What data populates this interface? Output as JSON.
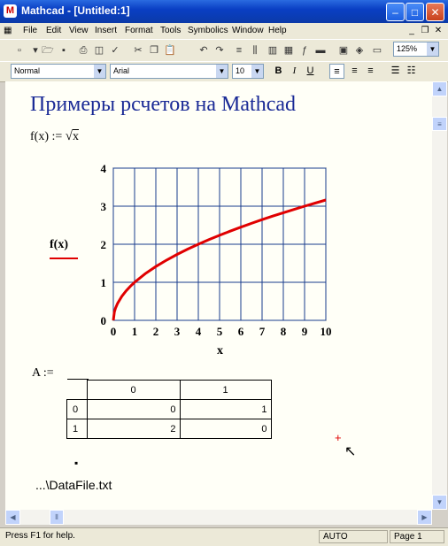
{
  "window": {
    "title": "Mathcad - [Untitled:1]",
    "app_icon": "mathcad-logo-icon"
  },
  "menu": [
    "File",
    "Edit",
    "View",
    "Insert",
    "Format",
    "Tools",
    "Symbolics",
    "Window",
    "Help"
  ],
  "toolbar": {
    "zoom": "125%"
  },
  "format_bar": {
    "style": "Normal",
    "font": "Arial",
    "size": "10"
  },
  "doc": {
    "heading": "Примеры рсчетов на Mathcad",
    "definition": {
      "lhs": "f(x)",
      "assign": ":=",
      "radicand": "x"
    },
    "plot_ylabel": "f(x)",
    "plot_xlabel": "x",
    "matrix_label": "A :=",
    "matrix": {
      "col_headers": [
        "0",
        "1"
      ],
      "row_headers": [
        "0",
        "1"
      ],
      "rows": [
        [
          "0",
          "1"
        ],
        [
          "2",
          "0"
        ]
      ]
    },
    "file_path": "...\\DataFile.txt"
  },
  "chart_data": {
    "type": "line",
    "function": "sqrt(x)",
    "xlim": [
      0,
      10
    ],
    "ylim": [
      0,
      4
    ],
    "xticks": [
      "0",
      "1",
      "2",
      "3",
      "4",
      "5",
      "6",
      "7",
      "8",
      "9",
      "10"
    ],
    "yticks": [
      "0",
      "1",
      "2",
      "3",
      "4"
    ],
    "xlabel": "x",
    "ylabel": "f(x)",
    "grid": true,
    "line_color": "#e00000",
    "grid_color": "#1a3c8c",
    "series": [
      {
        "x": [
          0,
          0.05,
          0.1,
          0.2,
          0.4,
          0.6,
          0.8,
          1,
          1.5,
          2,
          2.5,
          3,
          3.5,
          4,
          4.5,
          5,
          5.5,
          6,
          6.5,
          7,
          7.5,
          8,
          8.5,
          9,
          9.5,
          10
        ],
        "values": [
          0,
          0.224,
          0.316,
          0.447,
          0.632,
          0.775,
          0.894,
          1,
          1.225,
          1.414,
          1.581,
          1.732,
          1.871,
          2,
          2.121,
          2.236,
          2.345,
          2.449,
          2.55,
          2.646,
          2.739,
          2.828,
          2.915,
          3,
          3.082,
          3.162
        ]
      }
    ]
  },
  "status": {
    "help": "Press F1 for help.",
    "mode": "AUTO",
    "page": "Page 1"
  }
}
